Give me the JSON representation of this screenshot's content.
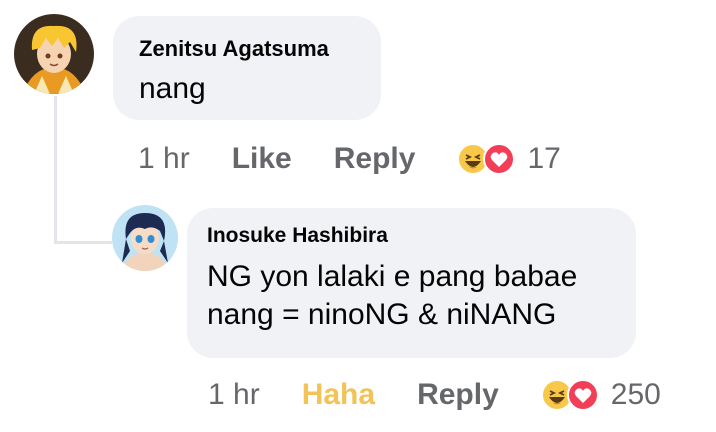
{
  "comments": [
    {
      "author": "Zenitsu Agatsuma",
      "text_lines": [
        "nang"
      ],
      "timestamp": "1 hr",
      "like_label": "Like",
      "reply_label": "Reply",
      "reactions": [
        "haha-icon",
        "love-icon"
      ],
      "reaction_count": "17"
    },
    {
      "author": "Inosuke Hashibira",
      "text_lines": [
        "NG yon lalaki e pang babae",
        "nang = ninoNG & niNANG"
      ],
      "timestamp": "1 hr",
      "like_label": "Haha",
      "reply_label": "Reply",
      "reactions": [
        "haha-icon",
        "love-icon"
      ],
      "reaction_count": "250"
    }
  ],
  "colors": {
    "bubble": "#f0f2f5",
    "meta_text": "#65676b",
    "haha_active": "#f2c357",
    "love": "#f33e58"
  }
}
